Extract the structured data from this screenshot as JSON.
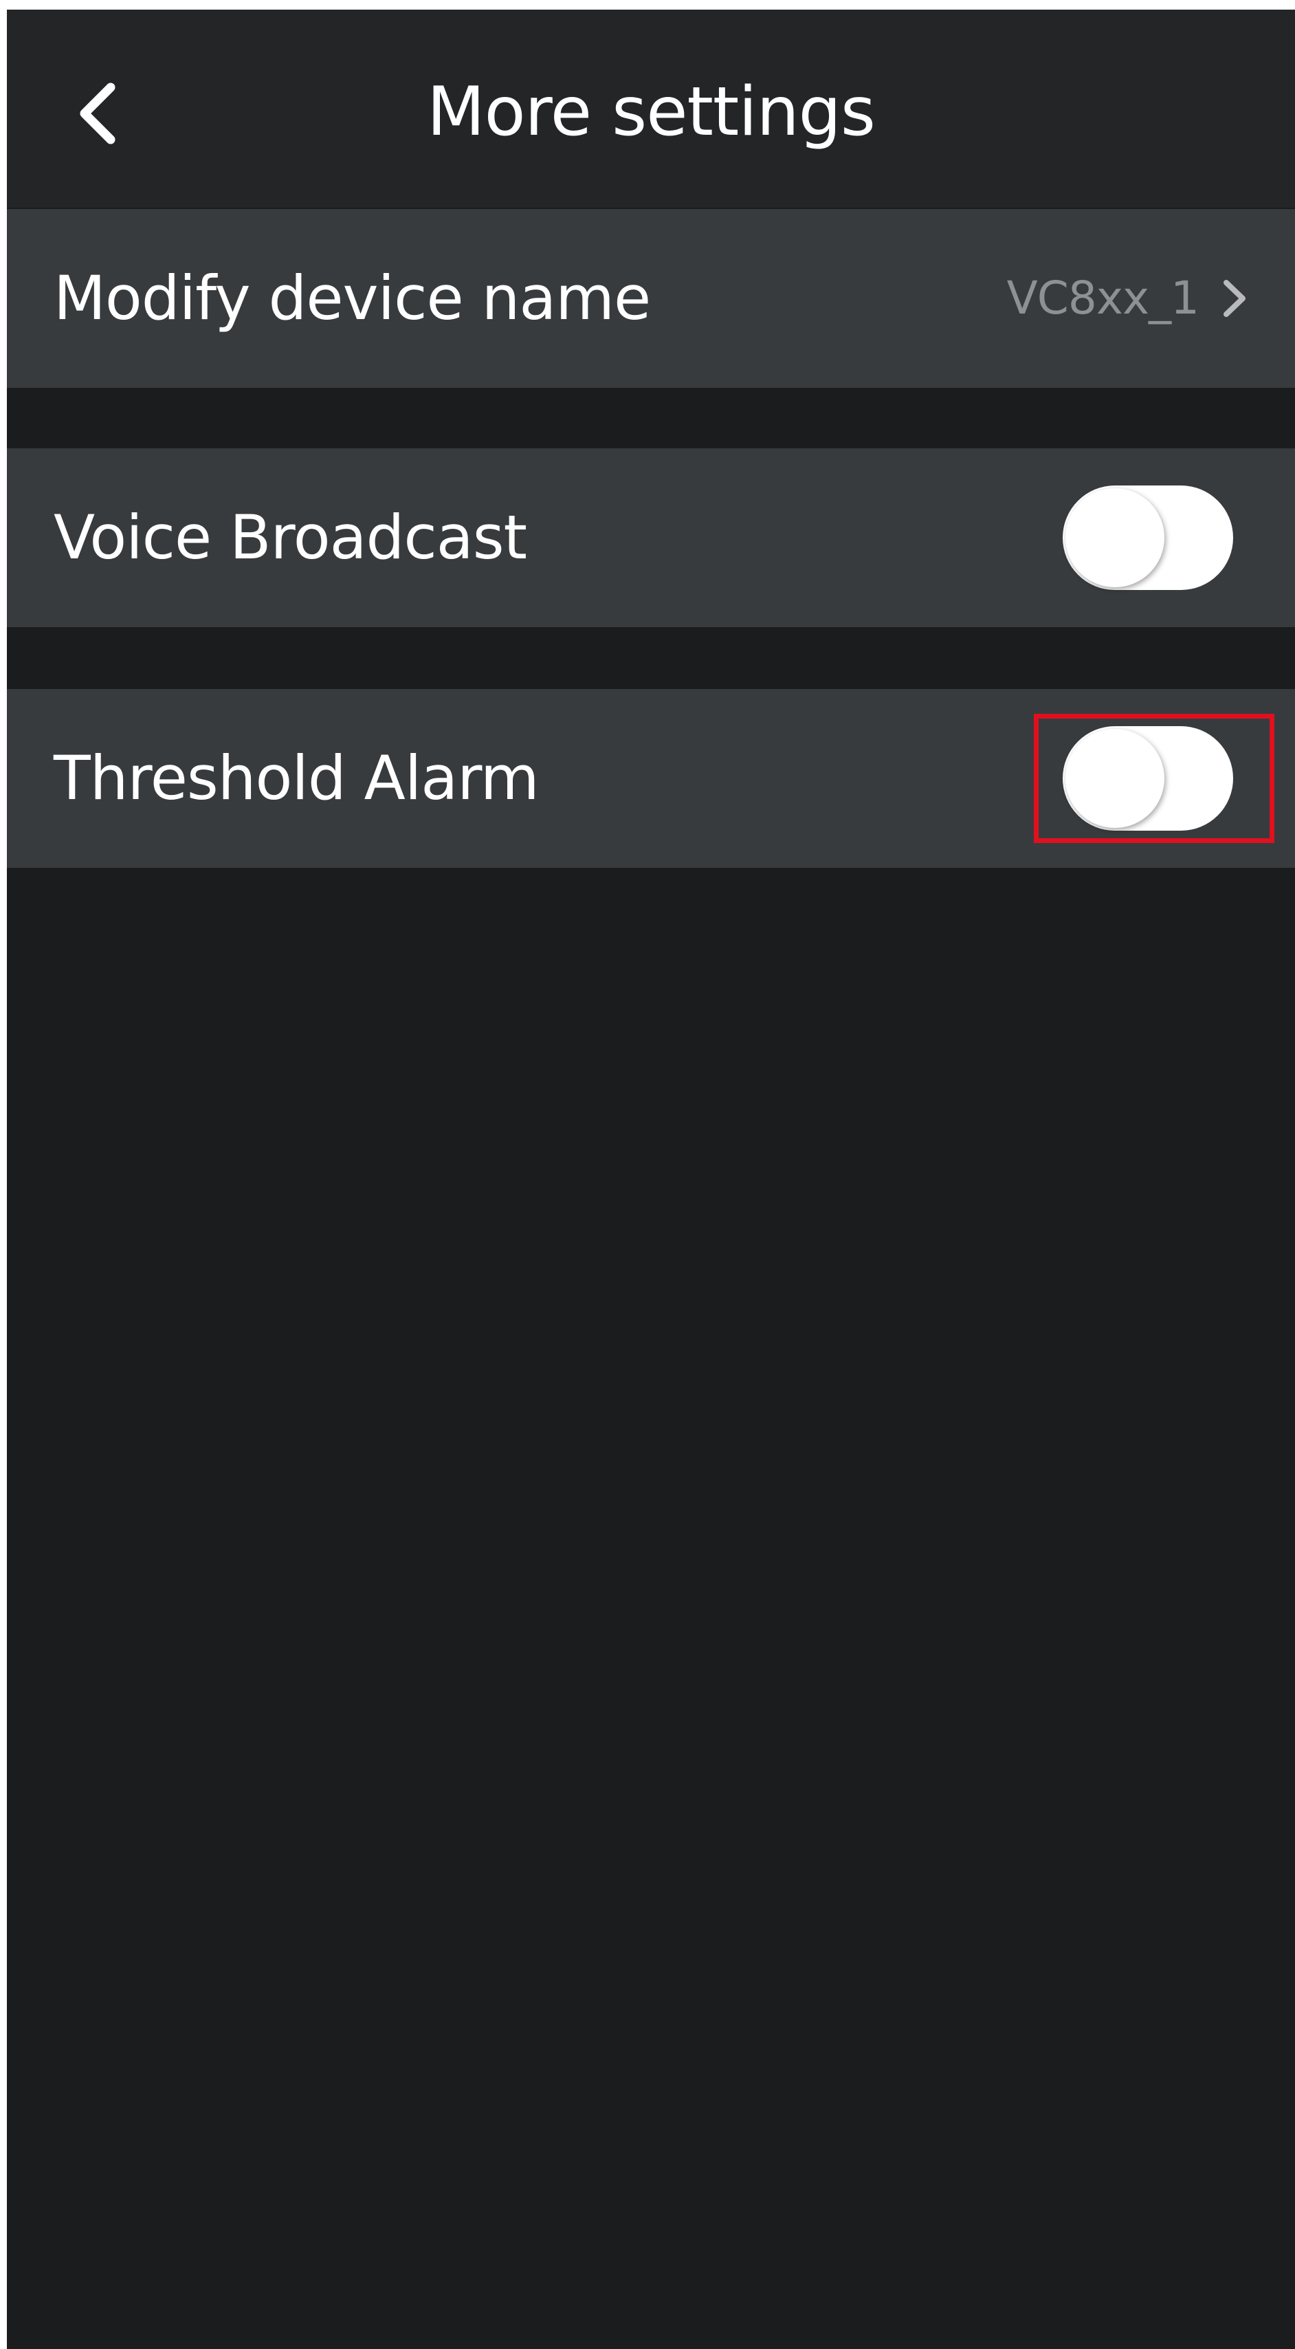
{
  "header": {
    "title": "More settings",
    "back_icon": "chevron-left-icon"
  },
  "settings": {
    "device_name": {
      "label": "Modify device name",
      "value": "VC8xx_1",
      "icon": "chevron-right-icon"
    },
    "voice_broadcast": {
      "label": "Voice Broadcast",
      "enabled": false
    },
    "threshold_alarm": {
      "label": "Threshold Alarm",
      "enabled": false,
      "highlighted": true
    }
  },
  "colors": {
    "background": "#1b1c1e",
    "header_bg": "#232527",
    "row_bg": "#383b3e",
    "secondary_text": "#8e9194",
    "highlight": "#e0101f"
  }
}
